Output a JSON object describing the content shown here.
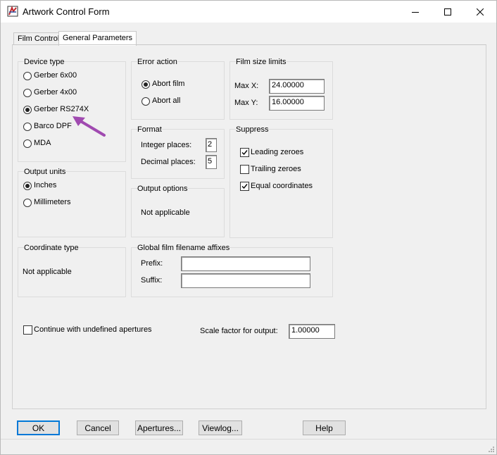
{
  "window": {
    "title": "Artwork Control Form"
  },
  "tabs": [
    {
      "label": "Film Control"
    },
    {
      "label": "General Parameters"
    }
  ],
  "device_type": {
    "title": "Device type",
    "options": [
      "Gerber 6x00",
      "Gerber 4x00",
      "Gerber RS274X",
      "Barco DPF",
      "MDA"
    ],
    "selected": "Gerber RS274X"
  },
  "output_units": {
    "title": "Output units",
    "options": [
      "Inches",
      "Millimeters"
    ],
    "selected": "Inches"
  },
  "coordinate_type": {
    "title": "Coordinate type",
    "text": "Not applicable"
  },
  "error_action": {
    "title": "Error action",
    "options": [
      "Abort film",
      "Abort all"
    ],
    "selected": "Abort film"
  },
  "format": {
    "title": "Format",
    "integer_label": "Integer places:",
    "integer_value": "2",
    "decimal_label": "Decimal places:",
    "decimal_value": "5"
  },
  "output_options": {
    "title": "Output options",
    "text": "Not applicable"
  },
  "film_size": {
    "title": "Film size limits",
    "max_x_label": "Max X:",
    "max_x_value": "24.00000",
    "max_y_label": "Max Y:",
    "max_y_value": "16.00000"
  },
  "suppress": {
    "title": "Suppress",
    "items": [
      {
        "label": "Leading zeroes",
        "checked": true
      },
      {
        "label": "Trailing zeroes",
        "checked": false
      },
      {
        "label": "Equal coordinates",
        "checked": true
      }
    ]
  },
  "affixes": {
    "title": "Global film filename affixes",
    "prefix_label": "Prefix:",
    "prefix_value": "",
    "suffix_label": "Suffix:",
    "suffix_value": ""
  },
  "continue_undefined": {
    "label": "Continue with undefined apertures",
    "checked": false
  },
  "scale_factor": {
    "label": "Scale factor for output:",
    "value": "1.00000"
  },
  "buttons": {
    "ok": "OK",
    "cancel": "Cancel",
    "apertures": "Apertures...",
    "viewlog": "Viewlog...",
    "help": "Help"
  },
  "colors": {
    "accent": "#0078d7",
    "annotation_arrow": "#a04ab0"
  }
}
